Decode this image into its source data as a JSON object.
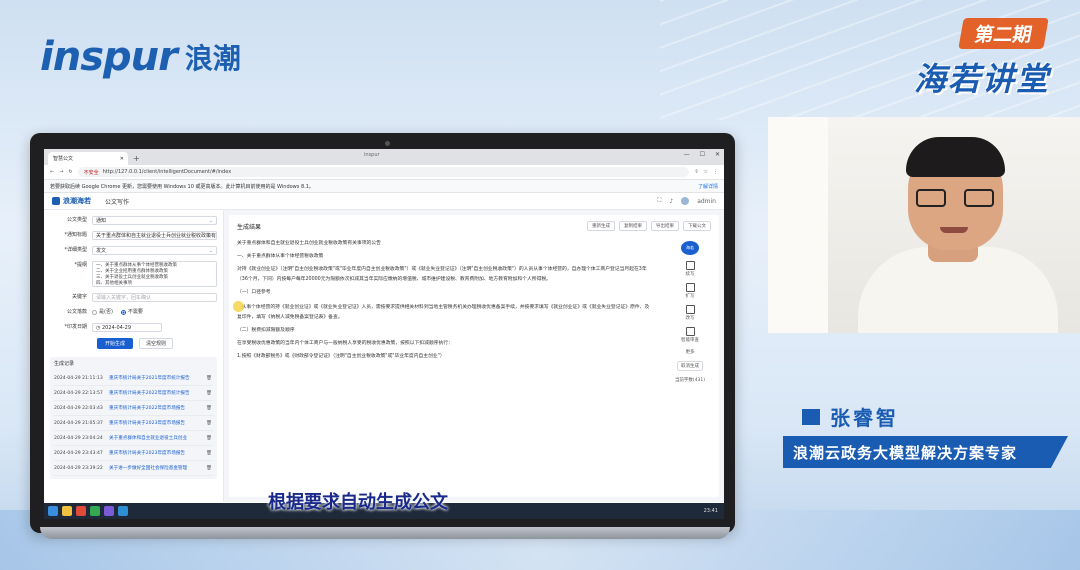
{
  "brand": {
    "logo_text": "inspur",
    "cn_text": "浪潮"
  },
  "episode": {
    "badge": "第二期",
    "series": "海若讲堂"
  },
  "browser": {
    "tab_title": "智慧公文",
    "window_title": "inspur",
    "insecure_label": "不安全",
    "url": "http://127.0.0.1/client/intelligentDocument/#/index",
    "infobar_text": "若要获取后续 Google Chrome 更新，您需要使用 Windows 10 或更高版本。此计算机目前使用的是 Windows 8.1。",
    "infobar_link": "了解详情"
  },
  "app": {
    "logo": "浪潮海若",
    "nav_item": "公文写作",
    "user": "admin"
  },
  "form": {
    "doc_type_label": "公文类型",
    "doc_type_value": "通知",
    "title_label": "*通知标题",
    "title_value": "关于重点群体和自主就业退役士兵创业就业税收政策有关事项的通知",
    "specific_type_label": "*详细类型",
    "specific_type_value": "发文",
    "outline_label": "*提纲",
    "outline_lines": [
      "一、关于重点群体从事个体经营税收政策",
      "二、关于企业招用重点群体税收政策",
      "三、关于退役士兵创业就业税收政策",
      "四、其他相关事项"
    ],
    "keyword_label": "关键字",
    "keyword_placeholder": "请输入关键字，回车确认",
    "stamp_label": "公文落款",
    "radio_yes": "是(否)",
    "radio_no": "不需要",
    "date_label": "*印发日期",
    "date_value": "2024-04-29",
    "generate_button": "开始生成",
    "clear_button": "清空规则"
  },
  "history": {
    "title": "生成记录",
    "items": [
      {
        "time": "2024-04-29 21:11:13",
        "name": "重庆市统计局关于2021年度市统计报告"
      },
      {
        "time": "2024-04-29 22:13:57",
        "name": "重庆市统计局关于2022年度市统计报告"
      },
      {
        "time": "2024-04-29 22:03:43",
        "name": "重庆市统计局关于2022年度市场报告"
      },
      {
        "time": "2024-04-29 21:05:37",
        "name": "重庆市统计局关于2023年度市场报告"
      },
      {
        "time": "2024-04-29 23:04:24",
        "name": "关于重点群体和自主就业退役士兵创业"
      },
      {
        "time": "2024-04-29 23:43:47",
        "name": "重庆市统计局关于2023年度市场报告"
      },
      {
        "time": "2024-04-29 23:39:22",
        "name": "关于进一步做好全国社会保险基金管理"
      }
    ]
  },
  "editor": {
    "heading": "生成结果",
    "actions": [
      "重新生成",
      "复制结果",
      "导出结果",
      "下载公文"
    ],
    "doc_title": "关于重点群体和自主就业退役士兵创业就业税收政策有关事项的公告",
    "paragraphs": [
      "一、关于重点群体从事个体经营税收政策",
      "对持《就业创业证》（注明\"自主创业税收政策\"或\"毕业年度内自主创业税收政策\"）或《就业失业登记证》（注明\"自主创业税收政策\"）的人员从事个体经营的，自办理个体工商户登记当月起在3年（36个月，下同）内按每户每年20000元为限额依次扣减其当年实际应缴纳的增值税、城市维护建设税、教育费附加、地方教育附加和个人所得税。",
      "（一）口径参考",
      "从事个体经营的持《就业创业证》或《就业失业登记证》人员，需按要求提供相关材料到当地主管税务机关办理税收优惠备案手续，并按要求填写《就业创业证》或《就业失业登记证》原件、及复印件，填写《纳税人减免税备案登记表》备查。",
      "（二）税费扣减限额及顺序",
      "在享受税收优惠政策的当年内个体工商户与一般纳税人享受的税收优惠政策，按照以下扣减顺序执行：",
      "1.按照《财政部税务》或《财政部令登记证》（注明\"自主创业税收政策\"或\"毕业年度内自主创业\"）"
    ],
    "robot_label": "海若",
    "tools": [
      "续写",
      "扩写",
      "改写",
      "智能审查"
    ],
    "more_label": "更多",
    "cancel_label": "取消生成",
    "word_count": "当前字数(431)"
  },
  "subtitle": "根据要求自动生成公文",
  "taskbar": {
    "time": "23:41"
  },
  "presenter": {
    "name": "张睿智",
    "title": "浪潮云政务大模型解决方案专家"
  }
}
